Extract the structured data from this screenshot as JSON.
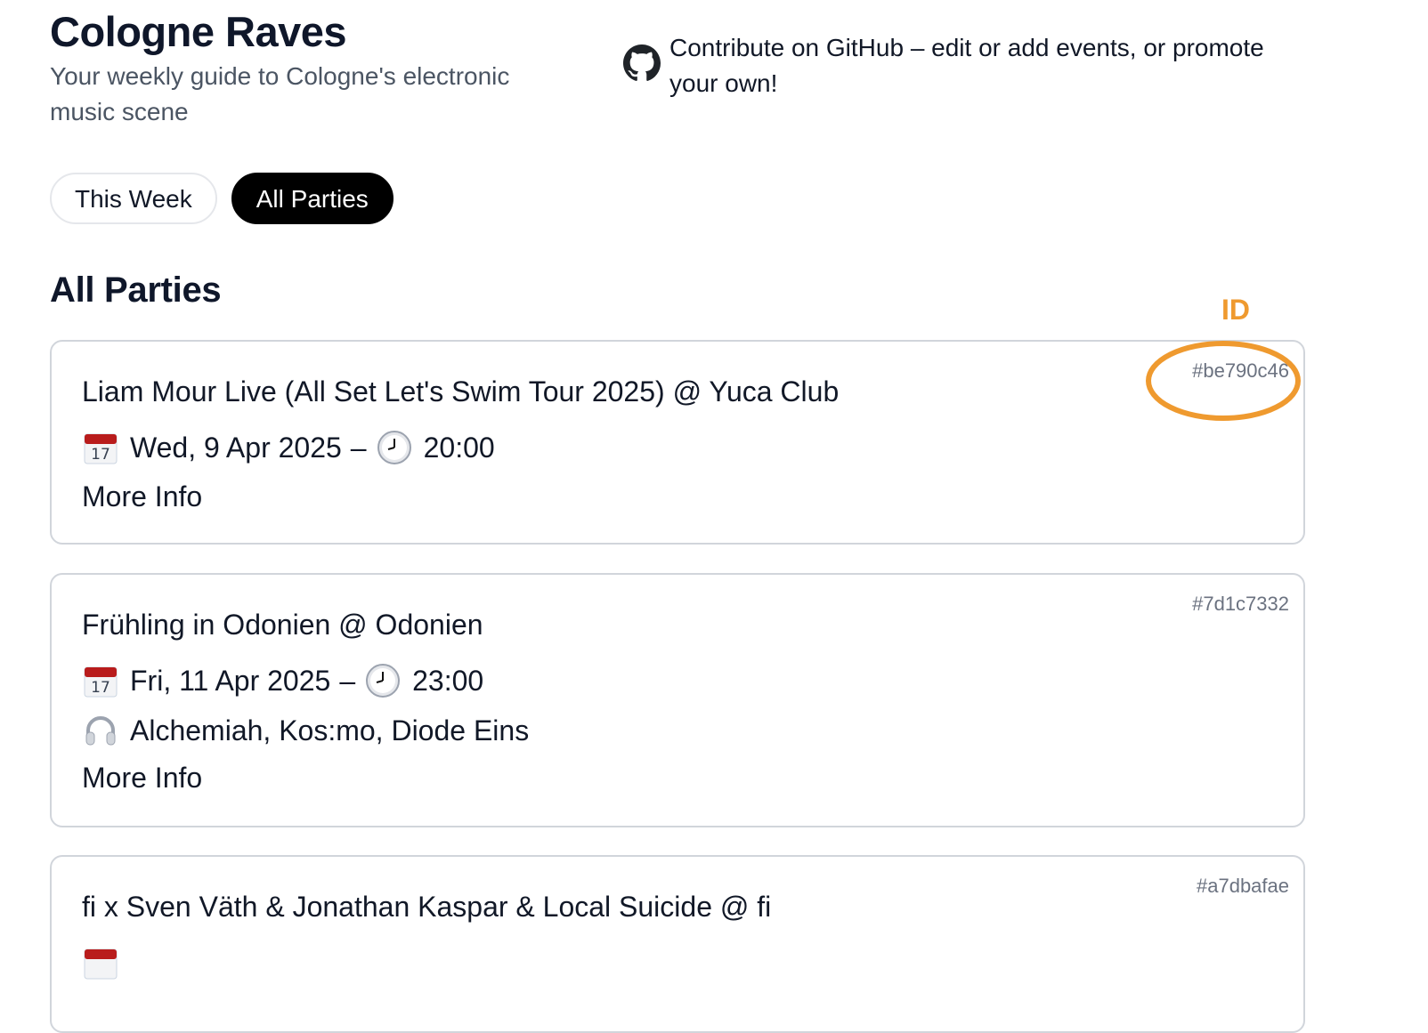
{
  "header": {
    "title": "Cologne Raves",
    "subtitle": "Your weekly guide to Cologne's electronic music scene",
    "github_text": "Contribute on GitHub – edit or add events, or promote your own!"
  },
  "tabs": [
    {
      "label": "This Week",
      "active": false
    },
    {
      "label": "All Parties",
      "active": true
    }
  ],
  "section_title": "All Parties",
  "annotation": {
    "label": "ID",
    "color": "#ef9a2f"
  },
  "events": [
    {
      "id": "#be790c46",
      "title": "Liam Mour Live (All Set Let's Swim Tour 2025) @ Yuca Club",
      "date": "Wed, 9 Apr 2025",
      "time": "20:00",
      "artists": "",
      "more": "More Info"
    },
    {
      "id": "#7d1c7332",
      "title": "Frühling in Odonien @ Odonien",
      "date": "Fri, 11 Apr 2025",
      "time": "23:00",
      "artists": "Alchemiah, Kos:mo, Diode Eins",
      "more": "More Info"
    },
    {
      "id": "#a7dbafae",
      "title": "fi x Sven Väth & Jonathan Kaspar & Local Suicide @ fi",
      "date": "",
      "time": "",
      "artists": "",
      "more": ""
    }
  ],
  "icons": {
    "github": "github-icon",
    "calendar": "calendar-icon",
    "clock": "clock-icon",
    "headphones": "headphones-icon"
  },
  "colors": {
    "active_tab": "#000000",
    "annotation": "#ef9a2f",
    "id_text": "#6b7280"
  }
}
